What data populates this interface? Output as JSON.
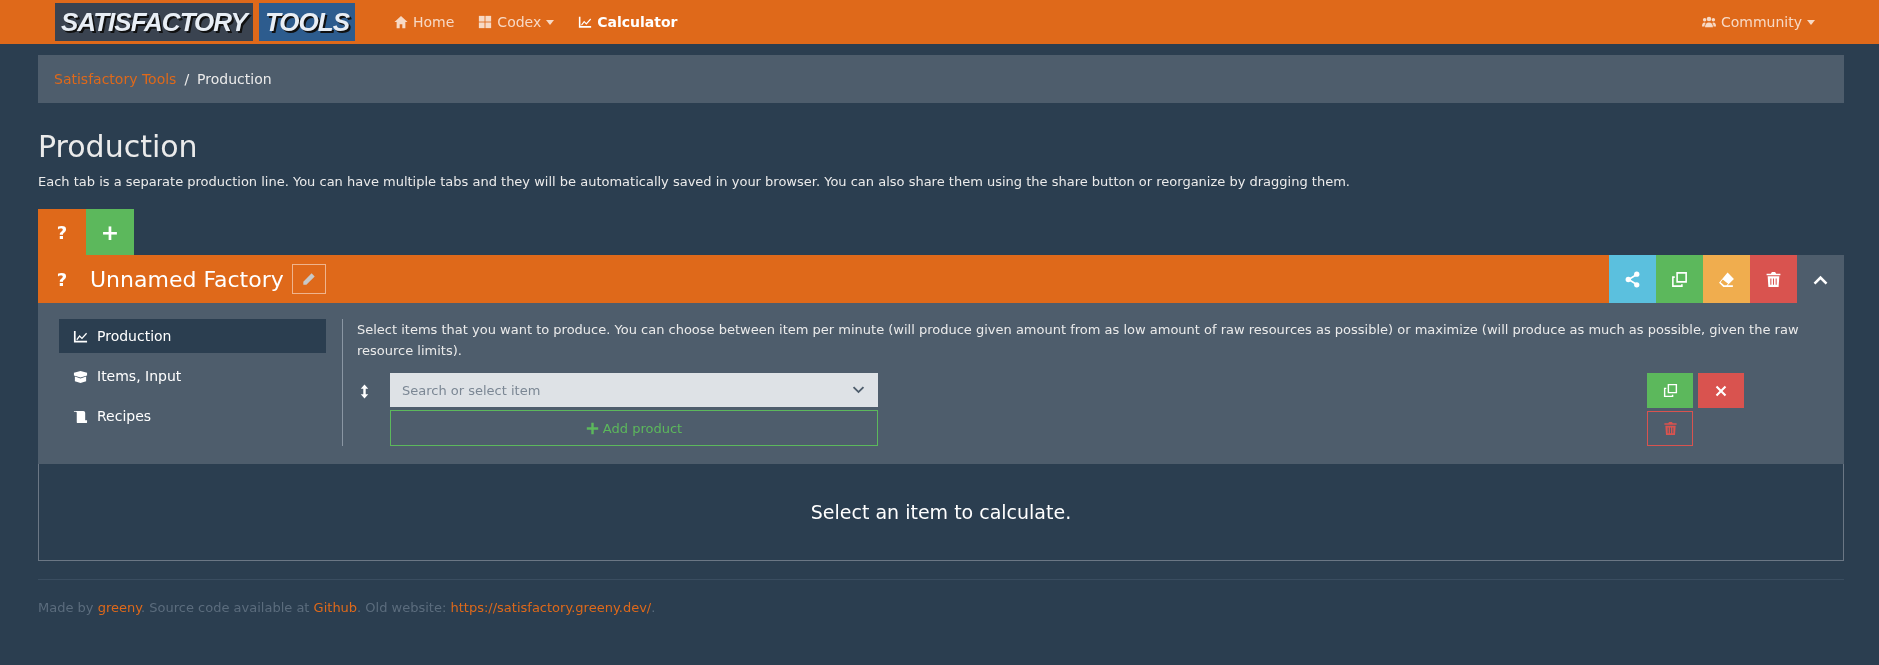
{
  "navbar": {
    "logo": {
      "word_1": "SATISFACTORY",
      "word_2": "TOOLS"
    },
    "items": [
      {
        "label": "Home",
        "kind": "home",
        "dropdown": false,
        "selected": false
      },
      {
        "label": "Codex",
        "kind": "grid",
        "dropdown": true,
        "selected": false
      },
      {
        "label": "Calculator",
        "kind": "chart",
        "dropdown": false,
        "selected": true
      }
    ],
    "right_items": [
      {
        "label": "Community",
        "kind": "users",
        "dropdown": true,
        "selected": false
      }
    ]
  },
  "breadcrumb": [
    {
      "label": "Satisfactory Tools",
      "kind": "link"
    },
    {
      "label": "/",
      "kind": "separator"
    },
    {
      "label": "Production",
      "kind": "current"
    }
  ],
  "page": {
    "title": "Production",
    "description": "Each tab is a separate production line. You can have multiple tabs and they will be automatically saved in your browser. You can also share them using the share button or reorganize by dragging them."
  },
  "tabs": [
    {
      "label": "?",
      "kind": "help",
      "selected": true
    },
    {
      "label": "+",
      "kind": "add",
      "selected": false
    }
  ],
  "factory": {
    "help": "?",
    "name": "Unnamed Factory",
    "actions": [
      {
        "kind": "share"
      },
      {
        "kind": "copy"
      },
      {
        "kind": "clear"
      },
      {
        "kind": "delete"
      },
      {
        "kind": "collapse"
      }
    ],
    "sidebar": [
      {
        "label": "Production",
        "kind": "chart",
        "selected": true
      },
      {
        "label": "Items, Input",
        "kind": "boxes",
        "selected": false
      },
      {
        "label": "Recipes",
        "kind": "scroll",
        "selected": false
      }
    ],
    "instructions": "Select items that you want to produce. You can choose between item per minute (will produce given amount from as low amount of raw resources as possible) or maximize (will produce as much as possible, given the raw resource limits).",
    "product_select": {
      "placeholder": "Search or select item"
    },
    "add_product": "Add product",
    "result": "Select an item to calculate."
  },
  "footer": [
    {
      "text": "Made by ",
      "kind": "text"
    },
    {
      "text": "greeny",
      "kind": "link"
    },
    {
      "text": ". Source code available at ",
      "kind": "text"
    },
    {
      "text": "Github",
      "kind": "link"
    },
    {
      "text": ". Old website: ",
      "kind": "text"
    },
    {
      "text": "https://satisfactory.greeny.dev/",
      "kind": "link"
    },
    {
      "text": ".",
      "kind": "text"
    }
  ]
}
